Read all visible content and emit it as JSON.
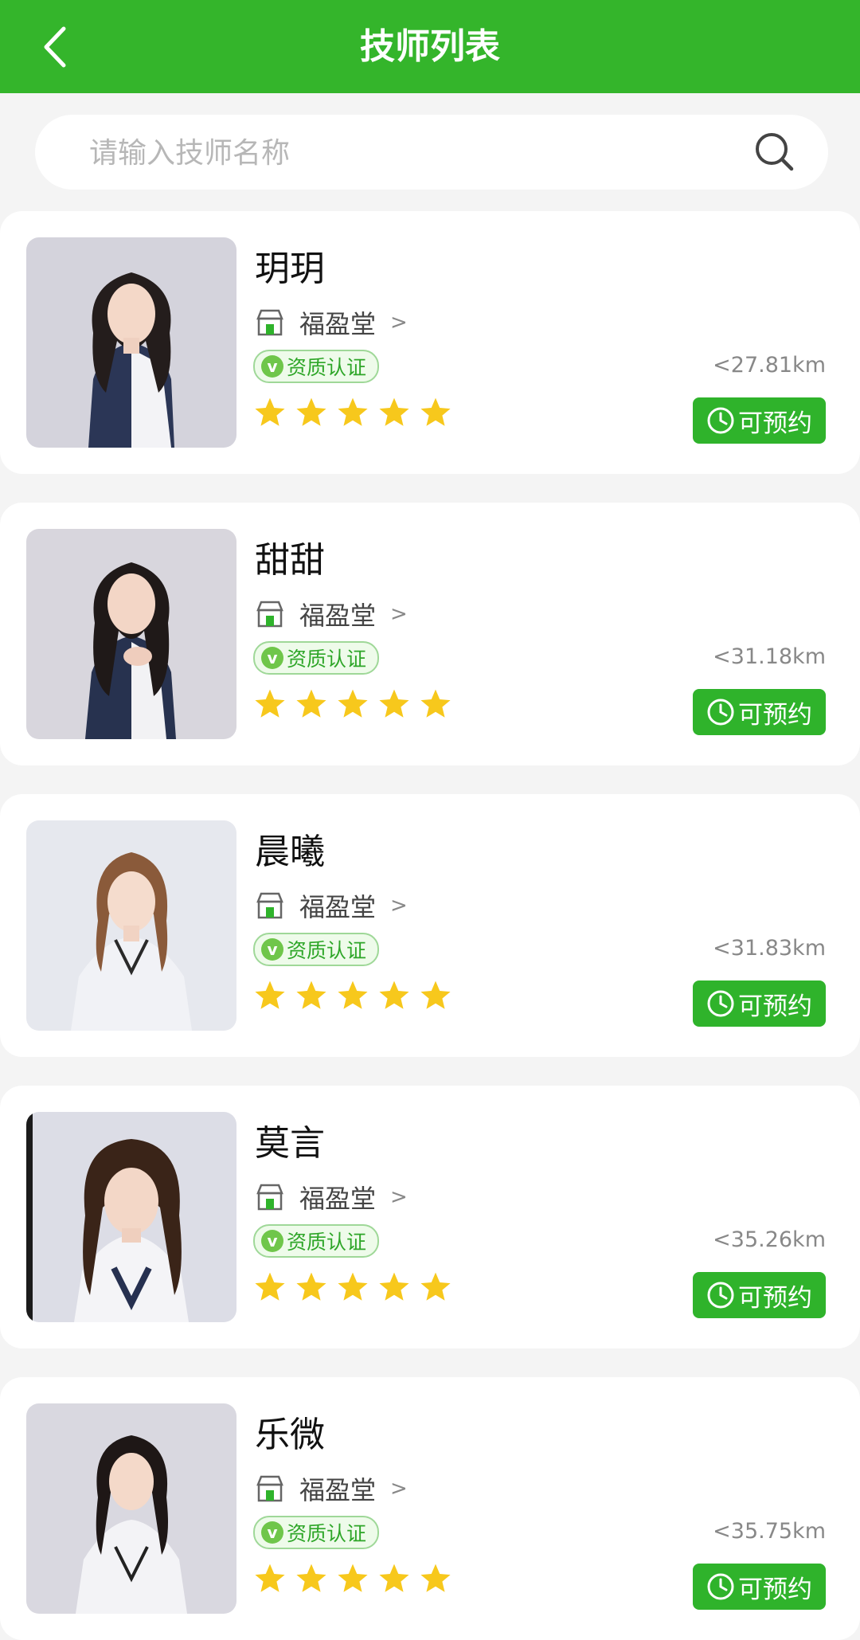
{
  "header": {
    "title": "技师列表",
    "back_icon": "chevron-left-icon",
    "bar_color": "#34b52b"
  },
  "search": {
    "placeholder": "请输入技师名称",
    "value": "",
    "icon": "search-icon"
  },
  "technicians": [
    {
      "name": "玥玥",
      "shop": "福盈堂",
      "shop_arrow": ">",
      "badge": "资质认证",
      "rating": 5,
      "distance": "<27.81km",
      "book_label": "可预约"
    },
    {
      "name": "甜甜",
      "shop": "福盈堂",
      "shop_arrow": ">",
      "badge": "资质认证",
      "rating": 5,
      "distance": "<31.18km",
      "book_label": "可预约"
    },
    {
      "name": "晨曦",
      "shop": "福盈堂",
      "shop_arrow": ">",
      "badge": "资质认证",
      "rating": 5,
      "distance": "<31.83km",
      "book_label": "可预约"
    },
    {
      "name": "莫言",
      "shop": "福盈堂",
      "shop_arrow": ">",
      "badge": "资质认证",
      "rating": 5,
      "distance": "<35.26km",
      "book_label": "可预约"
    },
    {
      "name": "乐微",
      "shop": "福盈堂",
      "shop_arrow": ">",
      "badge": "资质认证",
      "rating": 5,
      "distance": "<35.75km",
      "book_label": "可预约"
    }
  ],
  "colors": {
    "accent": "#2fb32b",
    "star": "#f7c81c",
    "badge_text": "#2ea628"
  }
}
